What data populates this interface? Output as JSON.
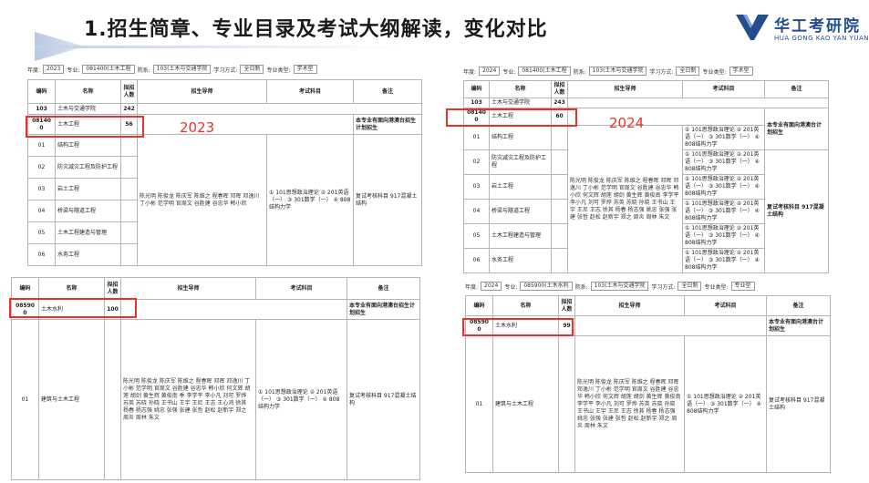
{
  "header": {
    "title": "1.招生简章、专业目录及考试大纲解读，变化对比",
    "logo_cn": "华工考研院",
    "logo_en": "HUA GONG KAO YAN YUAN"
  },
  "left": {
    "year_label": "2023",
    "filter1": {
      "year_l": "年度:",
      "year": "2023",
      "major_l": "专业:",
      "major": "081400(土木工程",
      "dept_l": "院系:",
      "dept": "103(土木与交通学院",
      "mode_l": "学习方式:",
      "mode": "全日制",
      "type_l": "专业类型:",
      "type": "学术型"
    },
    "table1": {
      "headers": [
        "编码",
        "名称",
        "拟招人数",
        "招生导师",
        "考试科目",
        "备注"
      ],
      "rows": [
        {
          "code": "103",
          "name": "土木与交通学院",
          "num": "242",
          "tutors": "",
          "exam": "",
          "note": ""
        },
        {
          "code": "081400",
          "name": "土木工程",
          "num": "56",
          "tutors": "",
          "exam": "",
          "note": "本专业有面向港澳台招生计划招生"
        },
        {
          "code": "01",
          "name": "结构工程",
          "num": "",
          "tutors": "陈光明 陈俊龙 陈庆军 陈维之 程春晖 邓晖 邓逸川 丁小彬 范学明 官周文 谷胜建 谷忠华 韩小欣",
          "exam": "① 101思想政治理论 ② 201英语（一） ③ 301数学（一） ④ 808结构力学",
          "note": "复试考核科目 917混凝土结构"
        },
        {
          "code": "02",
          "name": "防灾减灾工程及防护工程",
          "num": "",
          "tutors": "何文辉 何健 何海斌 胡莲 胡剑 胡灿 黄生辉 黄俊南",
          "exam": "",
          "note": ""
        },
        {
          "code": "03",
          "name": "岩土工程",
          "num": "",
          "tutors": "李学平 李小凡 刘可 罗烨 苏英 苏晓 孙晓",
          "exam": "",
          "note": ""
        },
        {
          "code": "04",
          "name": "桥梁与隧道工程",
          "num": "",
          "tutors": "王书山 王宇 王尼 王志 王心鸿 王 文 徐其 徐冬",
          "exam": "",
          "note": ""
        },
        {
          "code": "05",
          "name": "土木工程建造与管理",
          "num": "",
          "tutors": "杨春 杨志强 杨一峰 姚 忠 张 强 张建 张 哲",
          "exam": "",
          "note": ""
        },
        {
          "code": "06",
          "name": "水务工程",
          "num": "",
          "tutors": "赵 松 赵新宇 郑 之 周 炎 周 林 朱 文",
          "exam": "",
          "note": ""
        }
      ]
    },
    "table2": {
      "headers": [
        "编码",
        "名称",
        "拟招人数",
        "招生导师",
        "考试科目",
        "备注"
      ],
      "rows": [
        {
          "code": "085900",
          "name": "土木水利",
          "num": "100",
          "tutors": "",
          "exam": "",
          "note": "本专业有面向港澳台招生计划招生"
        },
        {
          "code": "01",
          "name": "建筑与土木工程",
          "num": "",
          "tutors": "陈光明 陈俊龙 陈庆军 陈维之 程春晖 邓晖 邓逸川 丁小彬 范学明 官周文 谷胜建 谷忠华 韩小欣 何文辉 胡莲 胡剑 黄生辉 黄俊南 季 李学平 李小凡 刘可 罗烨 苏英 苏晓 孙晓 王书山 王宇 王尼 王志 王心鸿 徐其 杨春 杨志强 姚忠 张强 张建 张哲 赵松 赵新宇 郑之 周炎 周林 朱文",
          "exam": "① 101思想政治理论 ② 201英语（一） ③ 301数学（一） ④ 808结构力学",
          "note": "复试考核科目 917混凝土结构"
        }
      ]
    }
  },
  "right": {
    "year_label": "2024",
    "filter1": {
      "year_l": "年度:",
      "year": "2024",
      "major_l": "专业:",
      "major": "081400(土木工程",
      "dept_l": "院系:",
      "dept": "103(土木与交通学院",
      "mode_l": "学习方式:",
      "mode": "全日制",
      "type_l": "专业类型:",
      "type": "学术型"
    },
    "filter2": {
      "year_l": "年度:",
      "year": "2024",
      "major_l": "专业:",
      "major": "085900(土木水利",
      "dept_l": "院系:",
      "dept": "103(土木与交通学院",
      "mode_l": "学习方式:",
      "mode": "全日制",
      "type_l": "专业类型:",
      "type": "专业型"
    },
    "table1": {
      "headers": [
        "编码",
        "名称",
        "拟招人数",
        "招生导师",
        "考试科目",
        "备注"
      ],
      "rows": [
        {
          "code": "103",
          "name": "土木与交通学院",
          "num": "243",
          "exam": ""
        },
        {
          "code": "081400",
          "name": "土木工程",
          "num": "60",
          "exam": ""
        },
        {
          "code": "01",
          "name": "结构工程",
          "num": "",
          "exam": "① 101思想政治理论 ② 201英语（一） ③ 301数学（一） ④ 808结构力学"
        },
        {
          "code": "02",
          "name": "防灾减灾工程及防护工程",
          "num": "",
          "exam": "① 101思想政治理论 ② 201英语（一） ③ 301数学（一） ④ 808结构力学"
        },
        {
          "code": "03",
          "name": "岩土工程",
          "num": "",
          "exam": "① 101思想政治理论 ② 201英语（一） ③ 301数学（一） ④ 808结构力学"
        },
        {
          "code": "04",
          "name": "桥梁与隧道工程",
          "num": "",
          "exam": "① 101思想政治理论 ② 201英语（一） ③ 301数学（一） ④ 808结构力学"
        },
        {
          "code": "05",
          "name": "土木工程建造与管理",
          "num": "",
          "exam": "① 101思想政治理论 ② 201英语（一） ③ 301数学（一） ④ 808结构力学"
        },
        {
          "code": "06",
          "name": "水务工程",
          "num": "",
          "exam": "① 101思想政治理论 ② 201英语（一） ③ 301数学（一） ④ 808结构力学"
        }
      ],
      "tutors": "陈光明 陈俊龙 陈庆军 陈维之 程春晖 邓晖 邓逸川 丁小彬 范学明 官周文 谷胜建 谷忠华 韩小欣 何文辉 胡莲 胡剑 黄生辉 黄俊南 李学平 李小凡 刘可 罗烨 苏英 苏晓 孙晓 王书山 王宇 王尼 王志 徐其 杨春 杨志强 姚忠 张强 张建 张哲 赵松 赵新宇 郑之 周炎 周林 朱文",
      "note": "本专业有面向港澳台计划招生",
      "note2": "复试考核科目 917混凝土结构"
    },
    "table2": {
      "headers": [
        "编码",
        "名称",
        "拟招人数",
        "招生导师",
        "考试科目",
        "备注"
      ],
      "rows": [
        {
          "code": "085900",
          "name": "土木水利",
          "num": "99",
          "tutors": "",
          "exam": "",
          "note": "本专业有面向港澳台计划招生"
        },
        {
          "code": "01",
          "name": "建筑与土木工程",
          "num": "",
          "tutors": "陈光明 陈俊龙 陈庆军 陈维之 程春晖 邓晖 邓逸川 丁小彬 范学明 官周文 谷胜建 谷忠华 韩小欣 何文辉 胡莲 胡剑 黄生辉 黄俊南 李学平 李小凡 刘可 罗烨 苏英 苏晓 孙晓 王书山 王宇 王尼 王志 徐其 杨春 杨志强 姚忠 张强 张建 张哲 赵松 赵新宇 郑之 周炎 周林 朱文",
          "exam": "① 101思想政治理论 ② 201英语（一） ③ 301数学（一） ④ 808结构力学",
          "note": "复试考核科目 917混凝土结构"
        }
      ]
    }
  },
  "colors": {
    "highlight": "#e8332a",
    "brand": "#234d8c"
  }
}
